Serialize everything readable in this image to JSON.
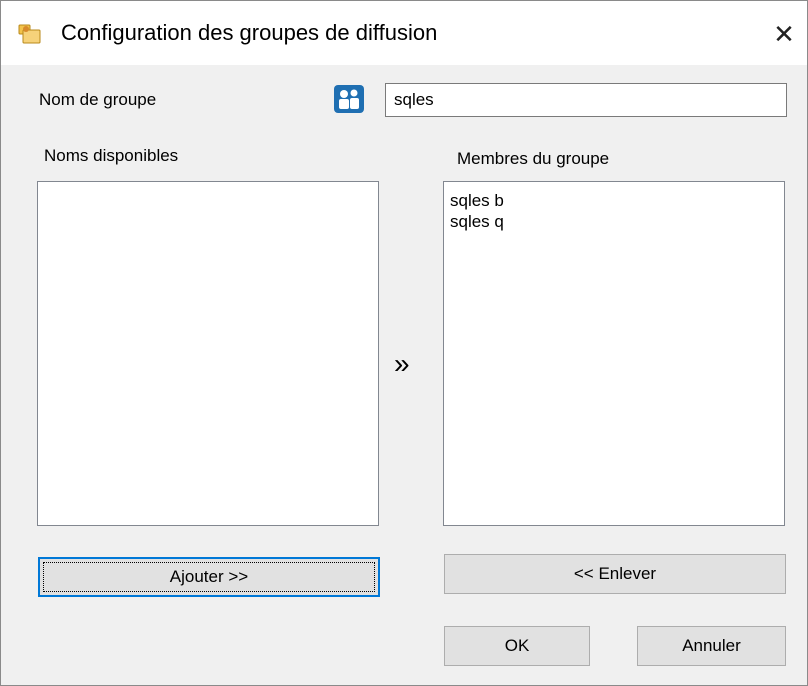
{
  "window": {
    "title": "Configuration des groupes de diffusion",
    "close_glyph": "✕"
  },
  "form": {
    "group_name_label": "Nom de groupe",
    "group_name_value": "sqles",
    "available_label": "Noms disponibles",
    "members_label": "Membres du groupe",
    "transfer_glyph": "»",
    "available_items": [],
    "members_items": [
      "sqles b",
      "sqles q"
    ]
  },
  "buttons": {
    "add": "Ajouter >>",
    "remove": "<< Enlever",
    "ok": "OK",
    "cancel": "Annuler"
  },
  "icons": {
    "app": "group-folder-icon",
    "group": "people-group-icon"
  },
  "colors": {
    "accent": "#0078d7",
    "icon_blue": "#1f6fb2",
    "icon_yellow": "#f3c34b"
  }
}
